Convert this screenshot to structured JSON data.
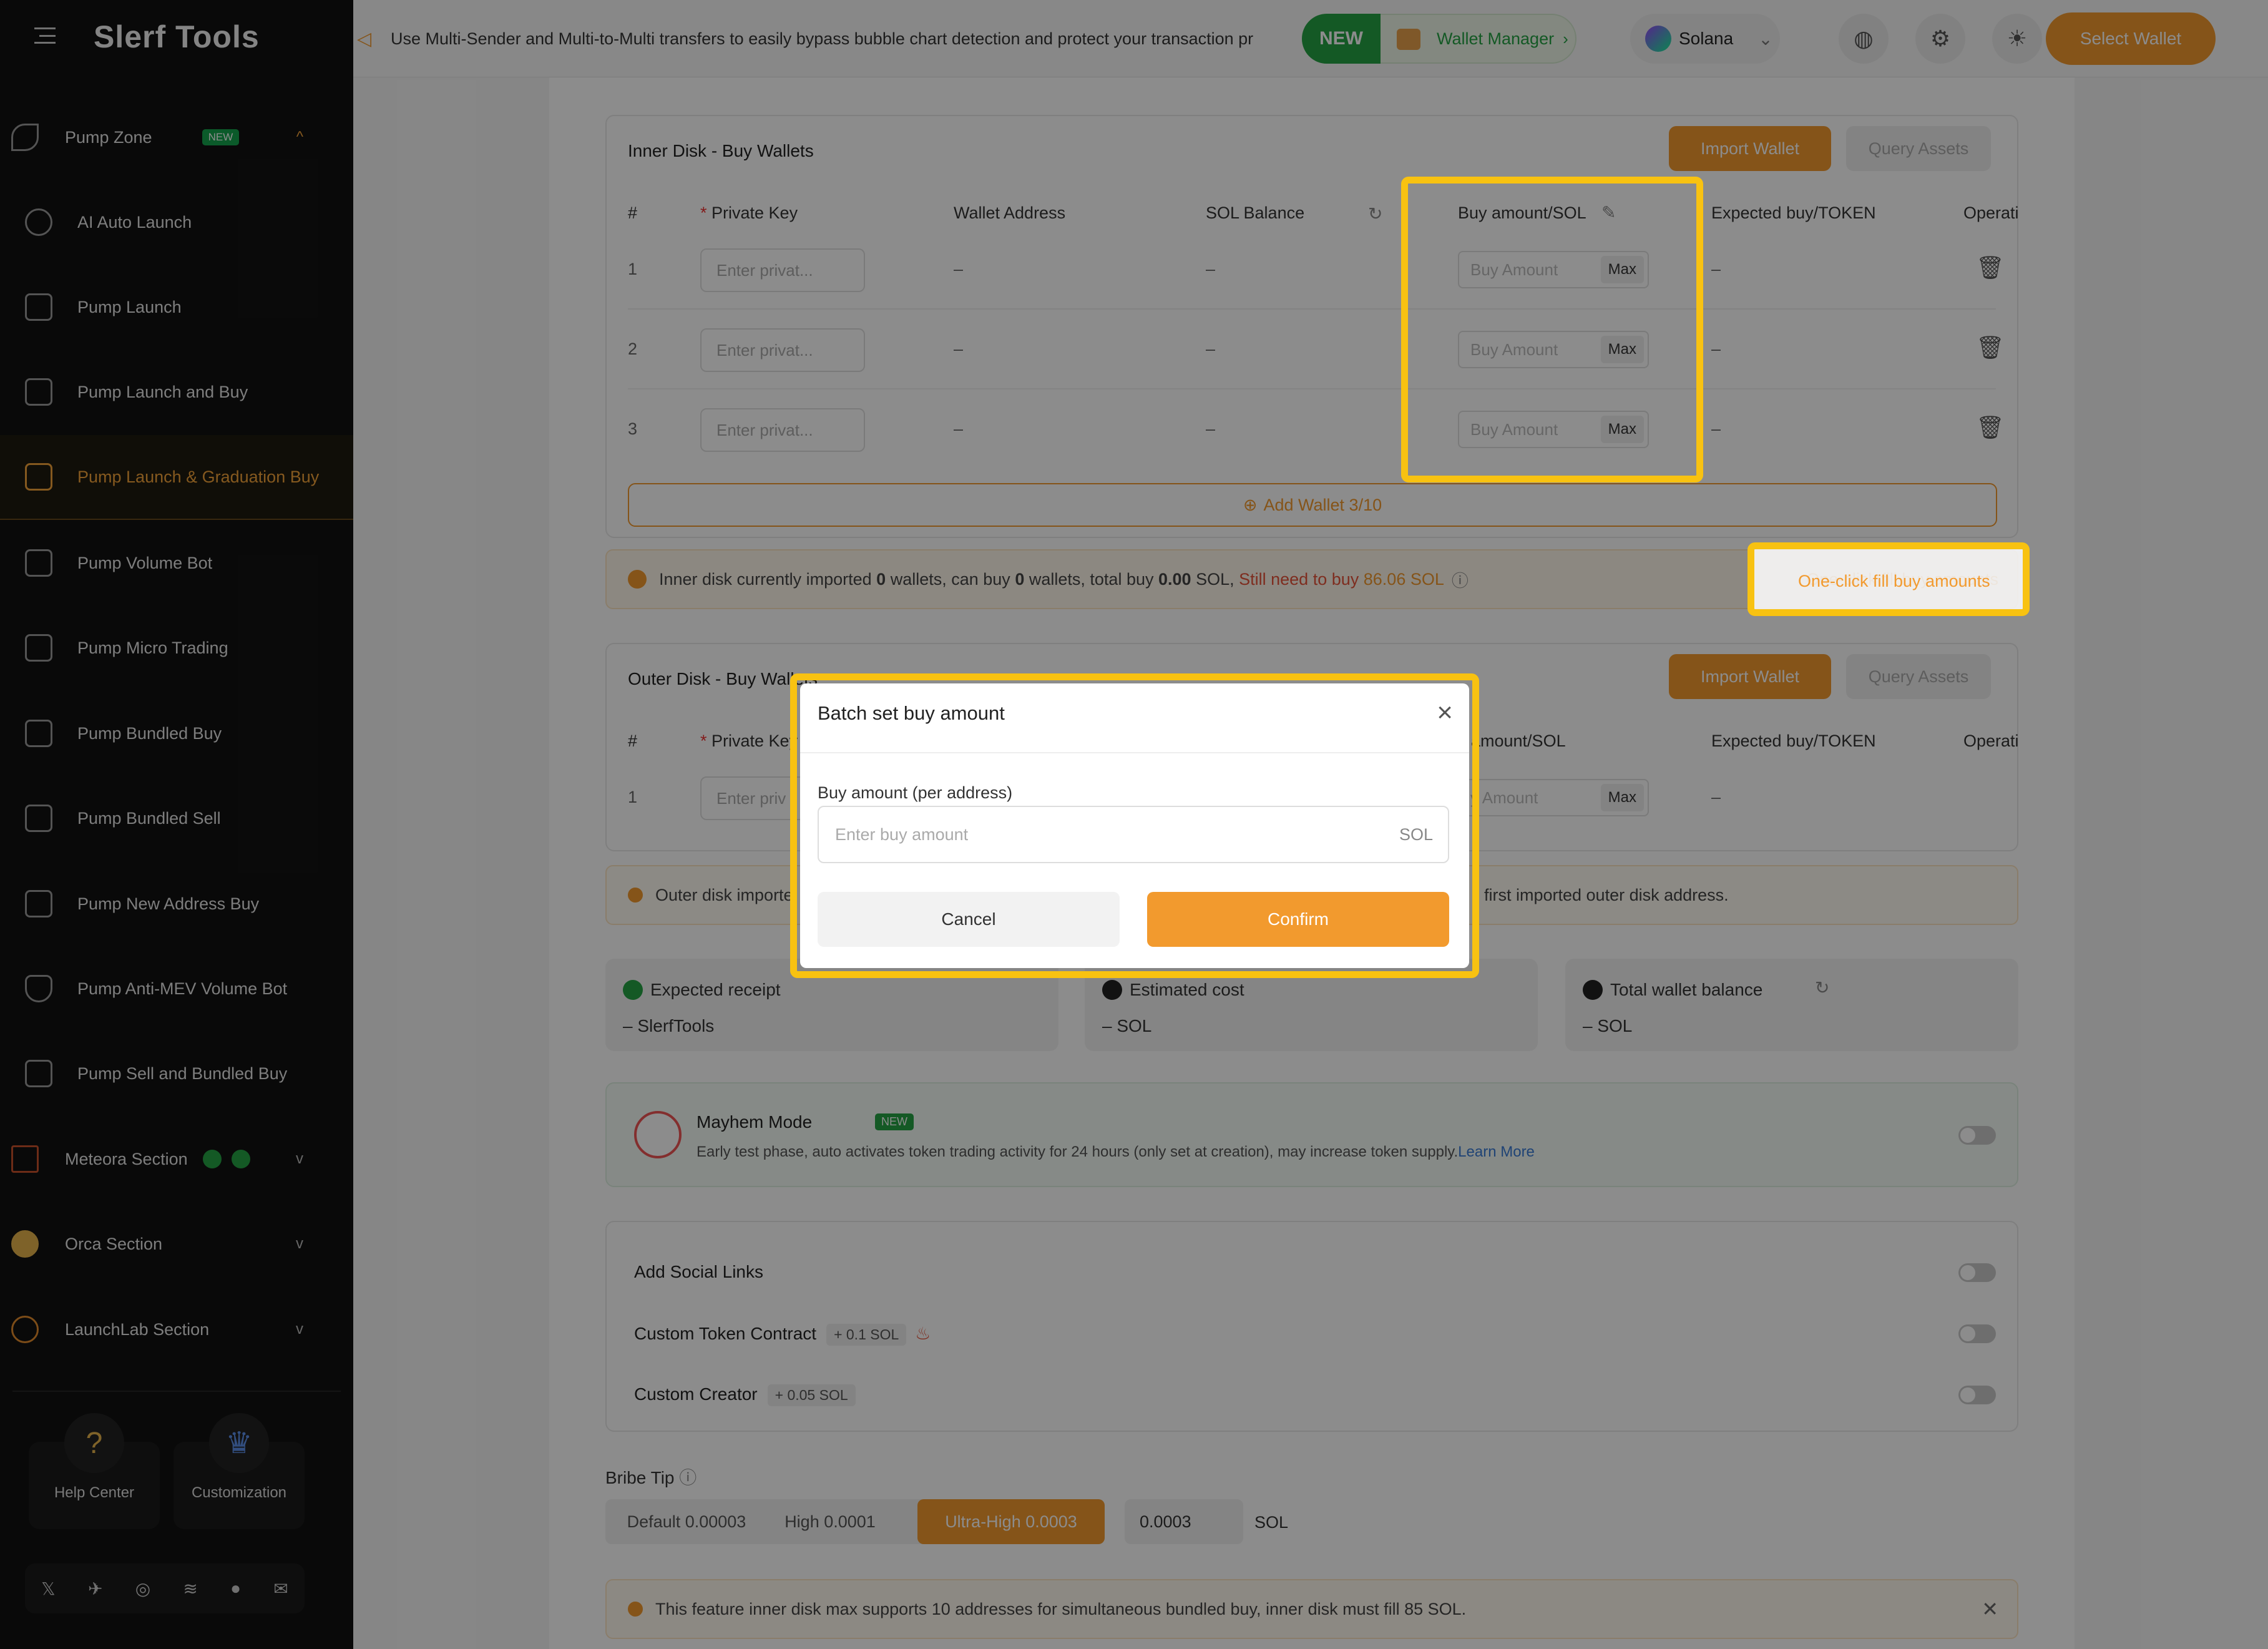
{
  "app": {
    "logo": "Slerf Tools"
  },
  "sidebar": {
    "items": [
      {
        "label": "Pump Zone",
        "badge": "NEW",
        "chevron": "^"
      },
      {
        "label": "AI Auto Launch"
      },
      {
        "label": "Pump Launch"
      },
      {
        "label": "Pump Launch and Buy"
      },
      {
        "label": "Pump Launch & Graduation Buy",
        "active": true
      },
      {
        "label": "Pump Volume Bot"
      },
      {
        "label": "Pump Micro Trading"
      },
      {
        "label": "Pump Bundled Buy"
      },
      {
        "label": "Pump Bundled Sell"
      },
      {
        "label": "Pump New Address Buy"
      },
      {
        "label": "Pump Anti-MEV Volume Bot"
      },
      {
        "label": "Pump Sell and Bundled Buy"
      },
      {
        "label": "Meteora Section",
        "chevron": "v"
      },
      {
        "label": "Orca Section",
        "chevron": "v"
      },
      {
        "label": "LaunchLab Section",
        "chevron": "v"
      }
    ],
    "help_center": "Help Center",
    "customization": "Customization",
    "socials": [
      "𝕏",
      "✈",
      "◎",
      "≋",
      "●",
      "✉"
    ]
  },
  "topbar": {
    "announcement": "Use Multi-Sender and Multi-to-Multi transfers to easily bypass bubble chart detection and protect your transaction pr",
    "wallet_manager_badge": "NEW",
    "wallet_manager": "Wallet Manager",
    "chain": "Solana",
    "select_wallet": "Select Wallet"
  },
  "inner": {
    "title": "Inner Disk - Buy Wallets",
    "import": "Import Wallet",
    "query": "Query Assets",
    "headers": {
      "num": "#",
      "key": "Private Key",
      "addr": "Wallet Address",
      "bal": "SOL Balance",
      "buy": "Buy amount/SOL",
      "exp": "Expected buy/TOKEN",
      "op": "Operati"
    },
    "rows": [
      {
        "n": "1",
        "key_ph": "Enter privat...",
        "addr": "–",
        "bal": "–",
        "buy_ph": "Buy Amount",
        "max": "Max",
        "exp": "–"
      },
      {
        "n": "2",
        "key_ph": "Enter privat...",
        "addr": "–",
        "bal": "–",
        "buy_ph": "Buy Amount",
        "max": "Max",
        "exp": "–"
      },
      {
        "n": "3",
        "key_ph": "Enter privat...",
        "addr": "–",
        "bal": "–",
        "buy_ph": "Buy Amount",
        "max": "Max",
        "exp": "–"
      }
    ],
    "add_wallet": "Add Wallet 3/10",
    "info_a": "Inner disk currently imported",
    "info_b": "0",
    "info_c": "wallets, can buy",
    "info_d": "0",
    "info_e": "wallets, total buy",
    "info_f": "0.00",
    "info_g": "SOL,",
    "info_h": "Still need to buy",
    "info_i": "86.06 SOL",
    "one_click": "One-click fill buy amounts"
  },
  "outer": {
    "title": "Outer Disk - Buy Wallets",
    "import": "Import Wallet",
    "query": "Query Assets",
    "headers": {
      "num": "#",
      "key": "Private Key",
      "buy": "y amount/SOL",
      "exp": "Expected buy/TOKEN",
      "op": "Operati"
    },
    "row": {
      "n": "1",
      "key_ph": "Enter priv",
      "buy_ph": "y Amount",
      "max": "Max",
      "exp": "–"
    },
    "info_left": "Outer disk importe",
    "info_right": "first imported outer disk address."
  },
  "stats": [
    {
      "label": "Expected receipt",
      "value": "– SlerfTools"
    },
    {
      "label": "Estimated cost",
      "value": "– SOL"
    },
    {
      "label": "Total wallet balance",
      "value": "– SOL"
    }
  ],
  "mayhem": {
    "title": "Mayhem Mode",
    "badge": "NEW",
    "desc": "Early test phase, auto activates token trading activity for 24 hours (only set at creation), may increase token supply.",
    "learn": "Learn More"
  },
  "options": [
    {
      "label": "Add Social Links"
    },
    {
      "label": "Custom Token Contract",
      "tag": "+ 0.1 SOL"
    },
    {
      "label": "Custom Creator",
      "tag": "+ 0.05 SOL"
    }
  ],
  "bribe": {
    "title": "Bribe Tip",
    "opts": [
      "Default 0.00003",
      "High 0.0001",
      "Ultra-High 0.0003"
    ],
    "value": "0.0003",
    "unit": "SOL"
  },
  "footer_notice": "This feature inner disk max supports 10 addresses for simultaneous bundled buy, inner disk must fill 85 SOL.",
  "modal": {
    "title": "Batch set buy amount",
    "field_label": "Buy amount (per address)",
    "placeholder": "Enter buy amount",
    "unit": "SOL",
    "cancel": "Cancel",
    "confirm": "Confirm"
  },
  "colors": {
    "accent": "#f29a2e",
    "highlight": "#f8c211",
    "sidebar_bg": "#121212",
    "green": "#25a244"
  }
}
